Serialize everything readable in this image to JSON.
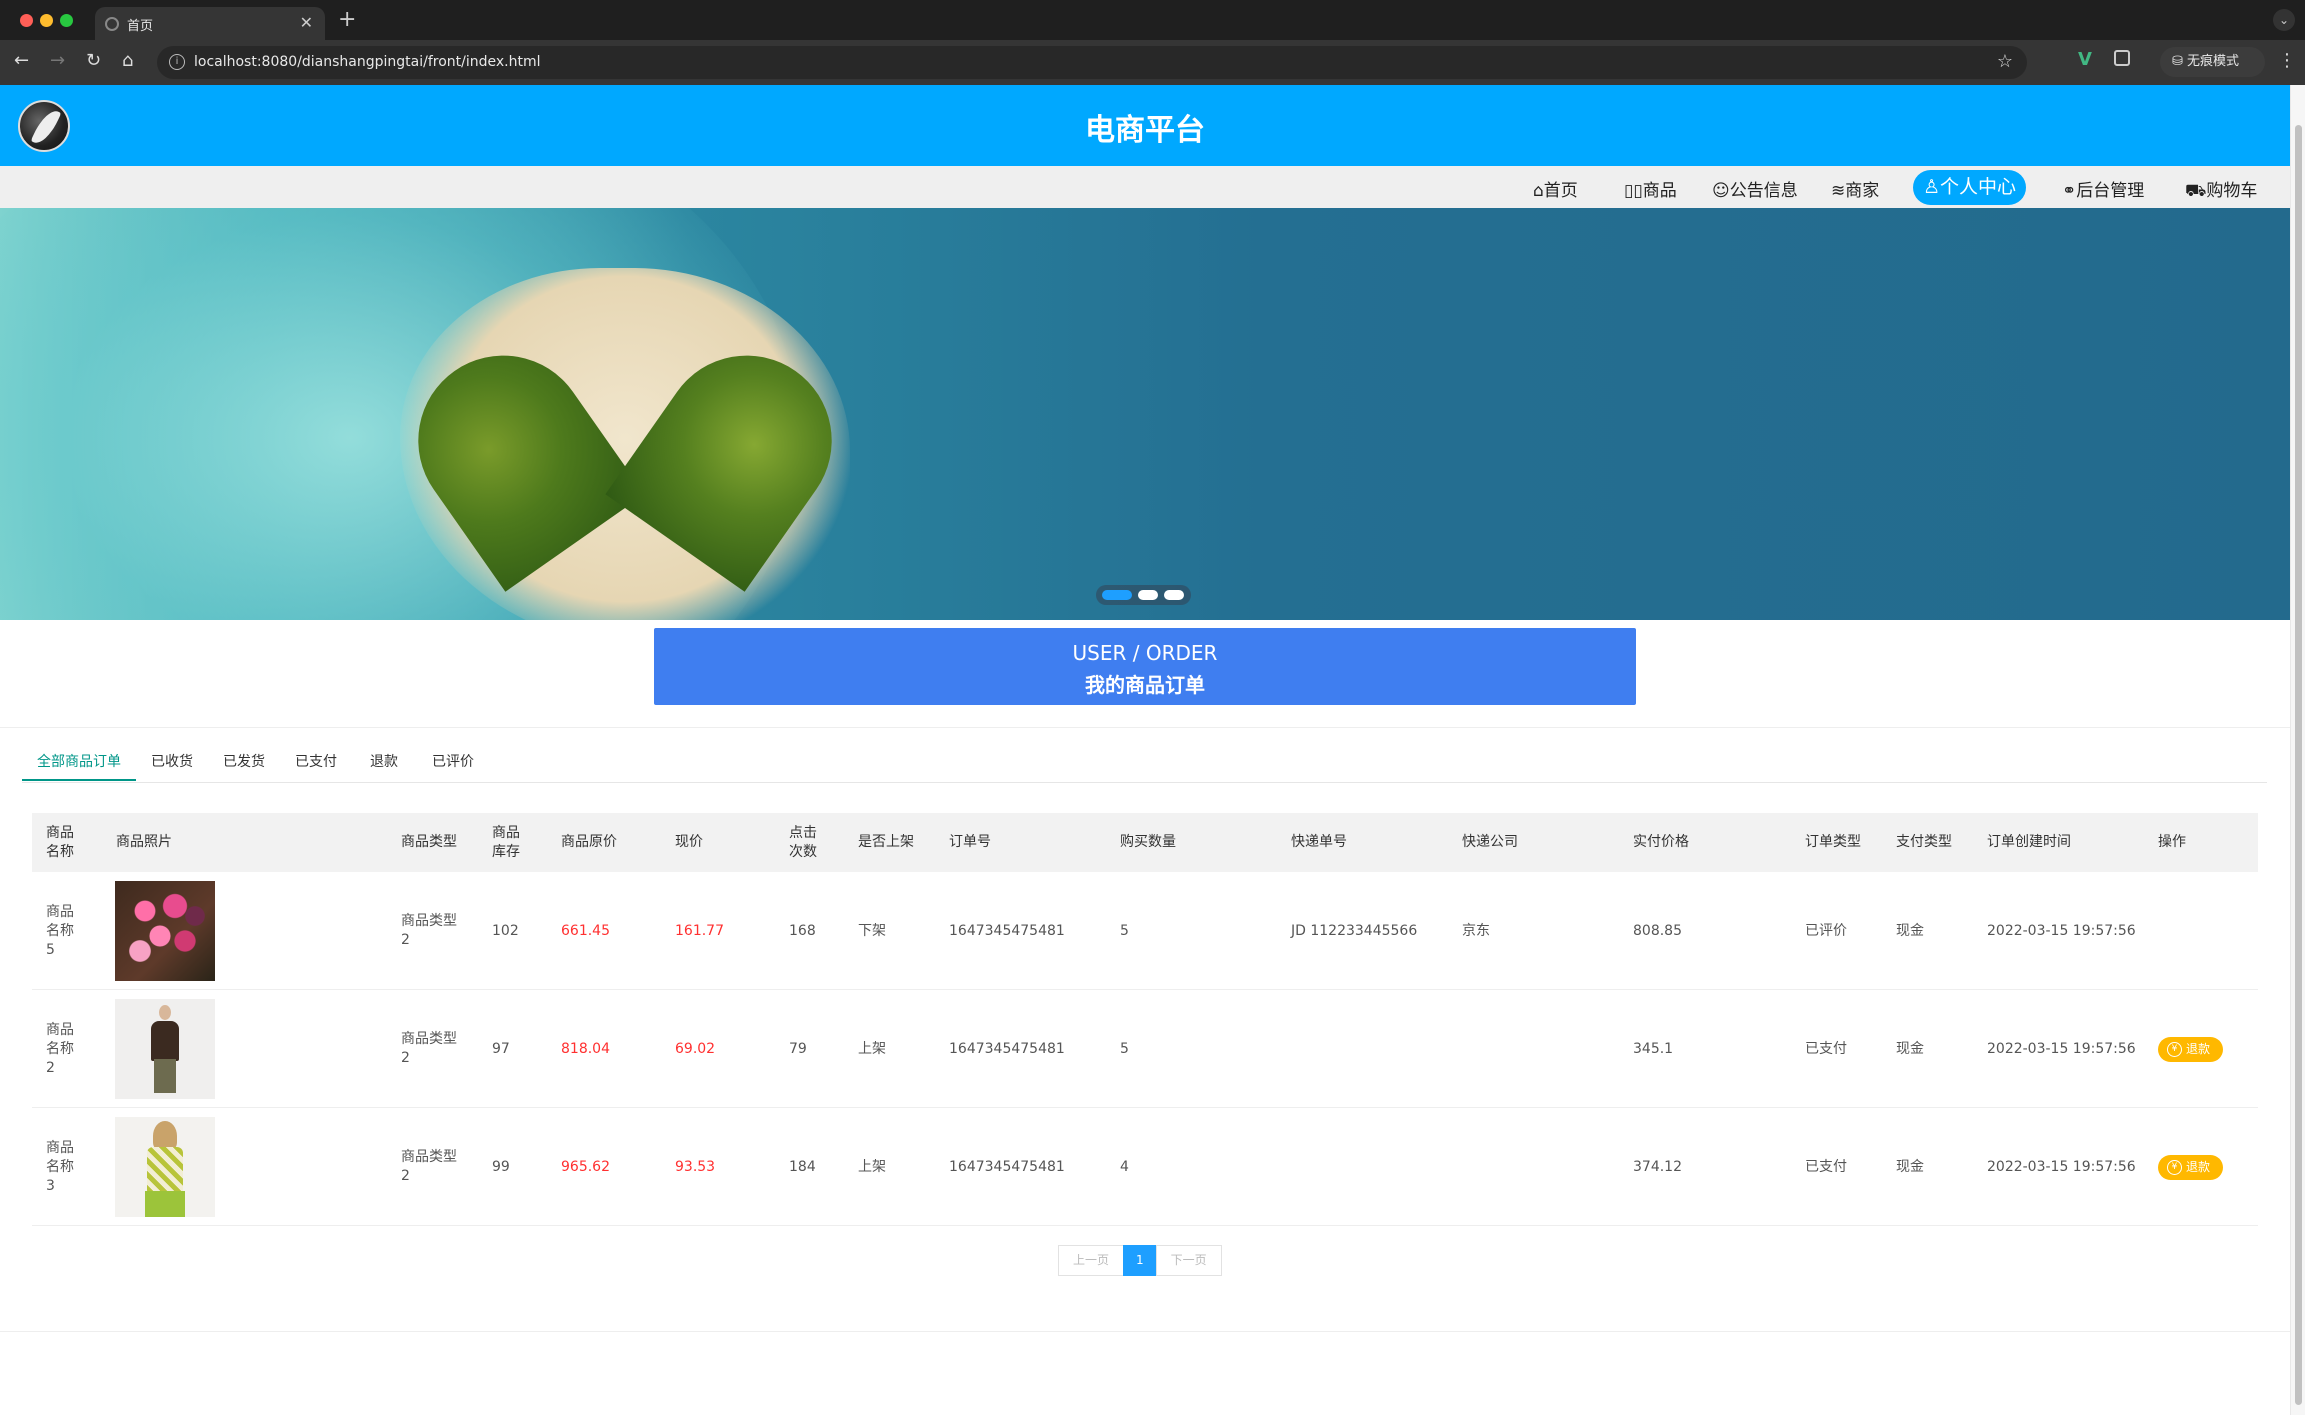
{
  "browser": {
    "tab_title": "首页",
    "url": "localhost:8080/dianshangpingtai/front/index.html",
    "incognito_label": "无痕模式"
  },
  "site": {
    "title": "电商平台"
  },
  "nav": {
    "items": [
      {
        "icon": "home-icon",
        "label": "首页"
      },
      {
        "icon": "goods-icon",
        "label": "商品"
      },
      {
        "icon": "notice-icon",
        "label": "公告信息"
      },
      {
        "icon": "shop-icon",
        "label": "商家"
      },
      {
        "icon": "user-icon",
        "label": "个人中心",
        "active": true
      },
      {
        "icon": "link-icon",
        "label": "后台管理"
      },
      {
        "icon": "cart-icon",
        "label": "购物车"
      }
    ]
  },
  "carousel": {
    "count": 3,
    "active_index": 0
  },
  "section": {
    "title_en": "USER / ORDER",
    "title_cn": "我的商品订单"
  },
  "order_tabs": [
    "全部商品订单",
    "已收货",
    "已发货",
    "已支付",
    "退款",
    "已评价"
  ],
  "table": {
    "headers": [
      "商品名称",
      "商品照片",
      "商品类型",
      "商品库存",
      "商品原价",
      "现价",
      "点击次数",
      "是否上架",
      "订单号",
      "购买数量",
      "快递单号",
      "快递公司",
      "实付价格",
      "订单类型",
      "支付类型",
      "订单创建时间",
      "操作"
    ],
    "rows": [
      {
        "name": "商品名称5",
        "type": "商品类型2",
        "stock": "102",
        "orig_price": "661.45",
        "price": "161.77",
        "clicks": "168",
        "listed": "下架",
        "order_no": "1647345475481",
        "qty": "5",
        "tracking": "JD 112233445566",
        "courier": "京东",
        "paid": "808.85",
        "order_type": "已评价",
        "pay_type": "现金",
        "created": "2022-03-15 19:57:56",
        "action": ""
      },
      {
        "name": "商品名称2",
        "type": "商品类型2",
        "stock": "97",
        "orig_price": "818.04",
        "price": "69.02",
        "clicks": "79",
        "listed": "上架",
        "order_no": "1647345475481",
        "qty": "5",
        "tracking": "",
        "courier": "",
        "paid": "345.1",
        "order_type": "已支付",
        "pay_type": "现金",
        "created": "2022-03-15 19:57:56",
        "action": "退款"
      },
      {
        "name": "商品名称3",
        "type": "商品类型2",
        "stock": "99",
        "orig_price": "965.62",
        "price": "93.53",
        "clicks": "184",
        "listed": "上架",
        "order_no": "1647345475481",
        "qty": "4",
        "tracking": "",
        "courier": "",
        "paid": "374.12",
        "order_type": "已支付",
        "pay_type": "现金",
        "created": "2022-03-15 19:57:56",
        "action": "退款"
      }
    ]
  },
  "pagination": {
    "prev": "上一页",
    "current": "1",
    "next": "下一页"
  },
  "colors": {
    "brand": "#00a8ff",
    "section_banner": "#3f7ef0",
    "tab_active": "#009688",
    "price_red": "#ff3030",
    "refund_button": "#ffb800"
  }
}
